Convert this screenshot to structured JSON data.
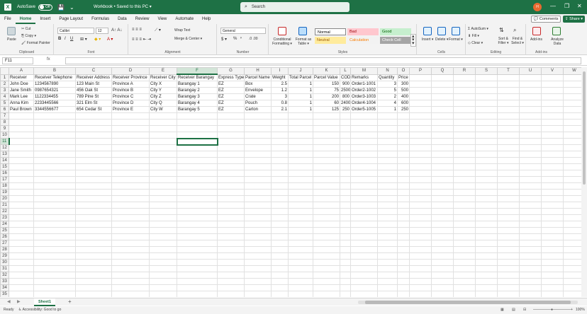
{
  "titlebar": {
    "app_initial": "X",
    "autosave_label": "AutoSave",
    "autosave_state": "Off",
    "document_title": "Workbook • Saved to this PC ▾",
    "search_placeholder": "Search",
    "user_initials": "H",
    "minimize": "—",
    "restore": "❐",
    "close": "✕"
  },
  "menu": {
    "tabs": [
      "File",
      "Home",
      "Insert",
      "Page Layout",
      "Formulas",
      "Data",
      "Review",
      "View",
      "Automate",
      "Help"
    ],
    "active": "Home",
    "comments": "💬 Comments",
    "share": "⇪ Share ▾"
  },
  "ribbon": {
    "clipboard": {
      "label": "Clipboard",
      "paste": "Paste",
      "cut": "✂ Cut",
      "copy": "⎘ Copy ▾",
      "format_painter": "🖌 Format Painter"
    },
    "font": {
      "label": "Font",
      "font_name": "Calibri",
      "font_size": "12",
      "bold": "B",
      "italic": "I",
      "underline": "U"
    },
    "alignment": {
      "label": "Alignment",
      "wrap_text": "Wrap Text",
      "merge_center": "Merge & Center ▾"
    },
    "number": {
      "label": "Number",
      "format": "General",
      "currency": "$ ▾",
      "percent": "%",
      "comma": "❜"
    },
    "styles": {
      "label": "Styles",
      "conditional_formatting": "Conditional Formatting ▾",
      "format_as_table": "Format as Table ▾",
      "cells": [
        {
          "name": "Normal",
          "bg": "#ffffff",
          "fg": "#000000"
        },
        {
          "name": "Bad",
          "bg": "#ffc7ce",
          "fg": "#9c0006"
        },
        {
          "name": "Good",
          "bg": "#c6efce",
          "fg": "#006100"
        },
        {
          "name": "Neutral",
          "bg": "#ffeb9c",
          "fg": "#9c5700"
        },
        {
          "name": "Calculation",
          "bg": "#f2f2f2",
          "fg": "#fa7d00"
        },
        {
          "name": "Check Cell",
          "bg": "#a5a5a5",
          "fg": "#ffffff"
        }
      ]
    },
    "cells": {
      "label": "Cells",
      "insert": "Insert ▾",
      "delete": "Delete ▾",
      "format": "Format ▾"
    },
    "editing": {
      "label": "Editing",
      "autosum": "Σ AutoSum ▾",
      "fill": "⬇ Fill ▾",
      "clear": "◇ Clear ▾",
      "sort_filter": "Sort & Filter ▾",
      "find_select": "Find & Select ▾"
    },
    "addins": {
      "label": "Add-ins",
      "addins": "Add-ins",
      "analyze": "Analyze Data"
    }
  },
  "formula_bar": {
    "name_box": "F11",
    "fx": "fx",
    "content": ""
  },
  "grid": {
    "columns": [
      "A",
      "B",
      "C",
      "D",
      "E",
      "F",
      "G",
      "H",
      "I",
      "J",
      "K",
      "L",
      "M",
      "N",
      "O",
      "P",
      "Q",
      "R",
      "S",
      "T",
      "U",
      "V",
      "W"
    ],
    "selected_col": "F",
    "selected_row": 11,
    "row_count": 35,
    "rows": [
      [
        "Receiver",
        "Receiver Telephone",
        "Receiver Address",
        "Receiver Province",
        "Receiver City",
        "Receiver Barangay",
        "Express Type",
        "Parcel Name",
        "Weight",
        "Total Parcel",
        "Parcel Value",
        "COD",
        "Remarks",
        "Quantity",
        "Price"
      ],
      [
        "John Doe",
        "1234567890",
        "123 Main St",
        "Province A",
        "City X",
        "Barangay 1",
        "EZ",
        "Box",
        "2.5",
        "1",
        "150",
        "900",
        "Order1-1001",
        "3",
        "300"
      ],
      [
        "Jane Smith",
        "0987654321",
        "456 Oak St",
        "Province B",
        "City Y",
        "Barangay 2",
        "EZ",
        "Envelope",
        "1.2",
        "1",
        "75",
        "2500",
        "Order2-1002",
        "5",
        "500"
      ],
      [
        "Mark Lee",
        "1122334455",
        "789 Pine St",
        "Province C",
        "City Z",
        "Barangay 3",
        "EZ",
        "Crate",
        "3",
        "1",
        "200",
        "800",
        "Order3-1003",
        "2",
        "400"
      ],
      [
        "Anna Kim",
        "2233445566",
        "321 Elm St",
        "Province D",
        "City Q",
        "Barangay 4",
        "EZ",
        "Pouch",
        "0.8",
        "1",
        "60",
        "2400",
        "Order4-1004",
        "4",
        "600"
      ],
      [
        "Paul Brown",
        "3344556677",
        "654 Cedar St",
        "Province E",
        "City W",
        "Barangay 5",
        "EZ",
        "Carton",
        "2.1",
        "1",
        "125",
        "250",
        "Order5-1005",
        "1",
        "250"
      ]
    ],
    "numeric_columns": [
      8,
      9,
      10,
      11,
      13,
      14
    ]
  },
  "sheets": {
    "tabs": [
      "Sheet1"
    ],
    "add": "+"
  },
  "status": {
    "ready": "Ready",
    "accessibility": "♿ Accessibility: Good to go",
    "zoom": "100%"
  }
}
